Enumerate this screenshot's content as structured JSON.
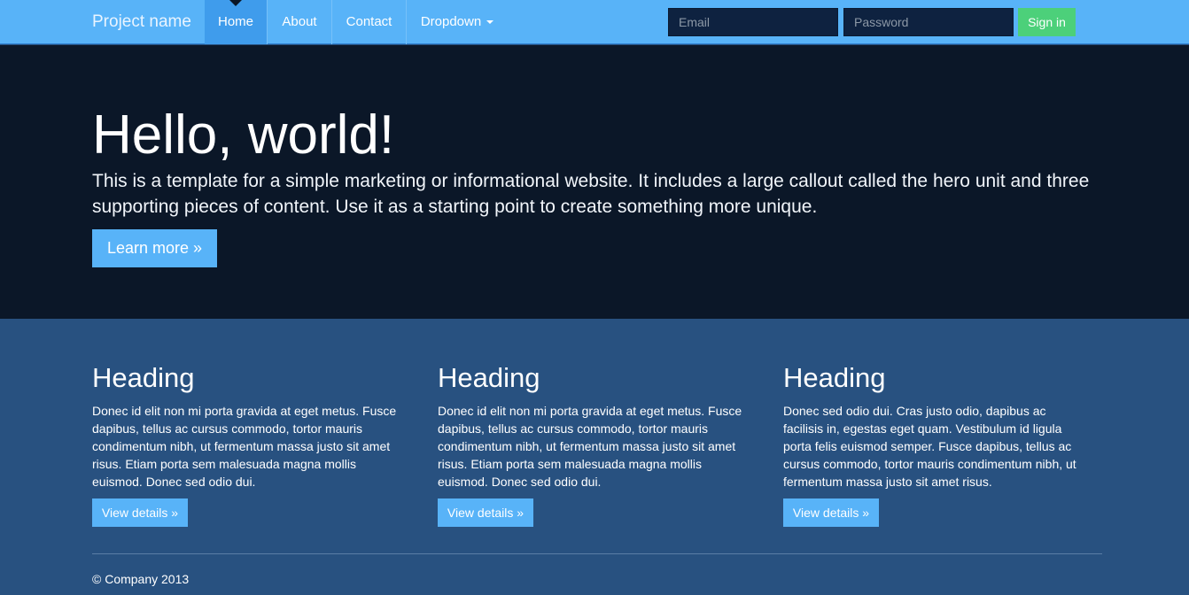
{
  "navbar": {
    "brand": "Project name",
    "items": [
      {
        "label": "Home",
        "active": true
      },
      {
        "label": "About",
        "active": false
      },
      {
        "label": "Contact",
        "active": false
      },
      {
        "label": "Dropdown",
        "active": false
      }
    ],
    "email_placeholder": "Email",
    "password_placeholder": "Password",
    "signin_label": "Sign in"
  },
  "hero": {
    "title": "Hello, world!",
    "text": "This is a template for a simple marketing or informational website. It includes a large callout called the hero unit and three supporting pieces of content. Use it as a starting point to create something more unique.",
    "button_label": "Learn more »"
  },
  "columns": [
    {
      "heading": "Heading",
      "text": "Donec id elit non mi porta gravida at eget metus. Fusce dapibus, tellus ac cursus commodo, tortor mauris condimentum nibh, ut fermentum massa justo sit amet risus. Etiam porta sem malesuada magna mollis euismod. Donec sed odio dui.",
      "button_label": "View details »"
    },
    {
      "heading": "Heading",
      "text": "Donec id elit non mi porta gravida at eget metus. Fusce dapibus, tellus ac cursus commodo, tortor mauris condimentum nibh, ut fermentum massa justo sit amet risus. Etiam porta sem malesuada magna mollis euismod. Donec sed odio dui.",
      "button_label": "View details »"
    },
    {
      "heading": "Heading",
      "text": "Donec sed odio dui. Cras justo odio, dapibus ac facilisis in, egestas eget quam. Vestibulum id ligula porta felis euismod semper. Fusce dapibus, tellus ac cursus commodo, tortor mauris condimentum nibh, ut fermentum massa justo sit amet risus.",
      "button_label": "View details »"
    }
  ],
  "footer": {
    "text": "© Company 2013"
  },
  "colors": {
    "navbar_bg": "#58b3f8",
    "hero_bg": "#0b1728",
    "content_bg": "#285180",
    "primary_button": "#58b3f8",
    "success_button": "#4cd07a"
  },
  "icons": {
    "dropdown_caret": "caret-down-icon"
  }
}
